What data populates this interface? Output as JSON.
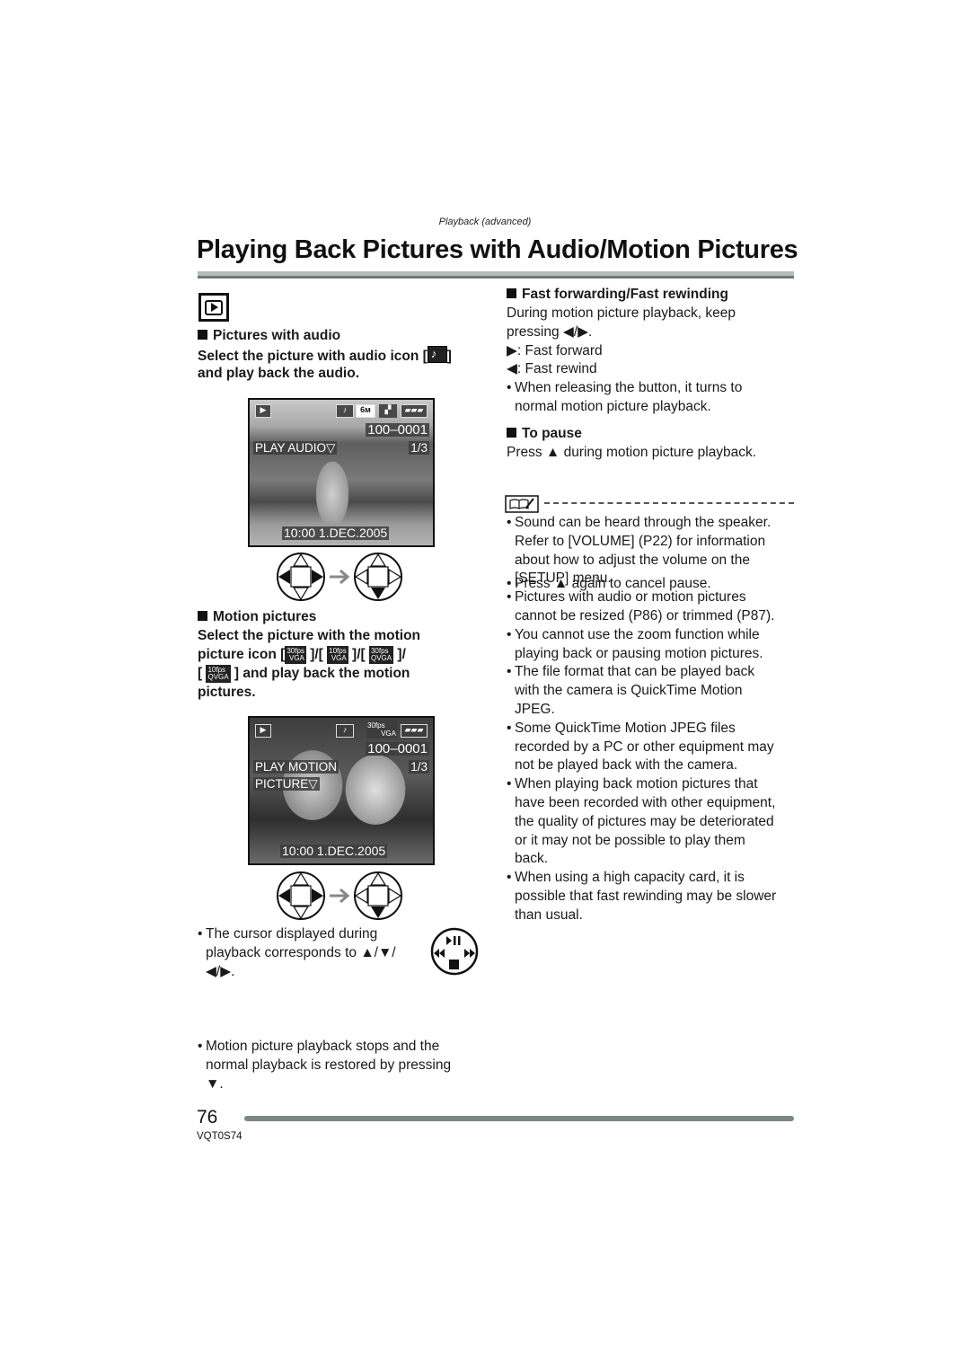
{
  "header": {
    "section_label": "Playback (advanced)",
    "title": "Playing Back Pictures with Audio/Motion Pictures"
  },
  "mode_icon": "playback-mode-icon",
  "left": {
    "audio": {
      "heading": "Pictures with audio",
      "instruction_line1_pre": "Select the picture with audio icon [",
      "instruction_line1_post": "]",
      "instruction_line2": "and play back the audio.",
      "screen": {
        "icons": [
          "play-icon",
          "audio-icon",
          "6M",
          "quality-icon",
          "battery-icon"
        ],
        "quality_label": "6м",
        "file_number": "100–0001",
        "prompt": "PLAY AUDIO▽",
        "counter": "1/3",
        "datetime": "10:00   1.DEC.2005"
      }
    },
    "motion": {
      "heading": "Motion pictures",
      "instruction_line1": "Select the picture with the motion",
      "instruction_line2_pre": "picture icon [",
      "instruction_line3_post": "] and play back the motion",
      "instruction_line4": "pictures.",
      "mode_icons": [
        {
          "fps": "30fps",
          "res": "VGA"
        },
        {
          "fps": "10fps",
          "res": "VGA"
        },
        {
          "fps": "30fps",
          "res": "QVGA"
        },
        {
          "fps": "10fps",
          "res": "QVGA"
        }
      ],
      "screen": {
        "fps_label": "30fps",
        "res_label": "VGA",
        "file_number": "100–0001",
        "prompt_line1": "PLAY MOTION",
        "prompt_line2": "PICTURE▽",
        "counter": "1/3",
        "datetime": "10:00   1.DEC.2005"
      }
    },
    "notes": [
      "The cursor displayed during playback corresponds to ▲/▼/◀/▶.",
      "Motion picture playback stops and the normal playback is restored by pressing ▼."
    ],
    "note1_lines": [
      "The cursor displayed during",
      "playback corresponds to ▲/▼/",
      "◀/▶."
    ],
    "note2_lines": [
      "Motion picture playback stops and the",
      "normal playback is restored by pressing",
      "▼."
    ],
    "control_icon_labels": {
      "top": "▶/II",
      "left": "◀◀",
      "right": "▶▶",
      "bottom": "■"
    }
  },
  "right": {
    "ff": {
      "heading": "Fast forwarding/Fast rewinding",
      "lines": [
        "During motion picture playback, keep",
        "pressing ◀/▶."
      ],
      "forward": "▶:  Fast forward",
      "rewind": "◀:  Fast rewind",
      "bullet_lines": [
        "When releasing the button, it turns to",
        "normal motion picture playback."
      ]
    },
    "pause": {
      "heading": "To pause",
      "line": "Press ▲ during motion picture playback.",
      "bullet": "Press ▲ again to cancel pause."
    },
    "notes": [
      [
        "Sound can be heard through the speaker.",
        "Refer to [VOLUME] (P22) for information",
        "about how to adjust the volume on the",
        "[SETUP] menu."
      ],
      [
        "Pictures with audio or motion pictures",
        "cannot be resized (P86) or trimmed (P87)."
      ],
      [
        "You cannot use the zoom function while",
        "playing back or pausing motion pictures."
      ],
      [
        "The file format that can be played back",
        "with the camera is QuickTime Motion",
        "JPEG."
      ],
      [
        "Some QuickTime Motion JPEG files",
        "recorded by a PC or other equipment may",
        "not be played back with the camera."
      ],
      [
        "When playing back motion pictures that",
        "have been recorded with other equipment,",
        "the quality of pictures may be deteriorated",
        "or it may not be possible to play them",
        "back."
      ],
      [
        "When using a high capacity card, it is",
        "possible that fast rewinding may be slower",
        "than usual."
      ]
    ]
  },
  "footer": {
    "page_number": "76",
    "doc_code": "VQT0S74"
  }
}
